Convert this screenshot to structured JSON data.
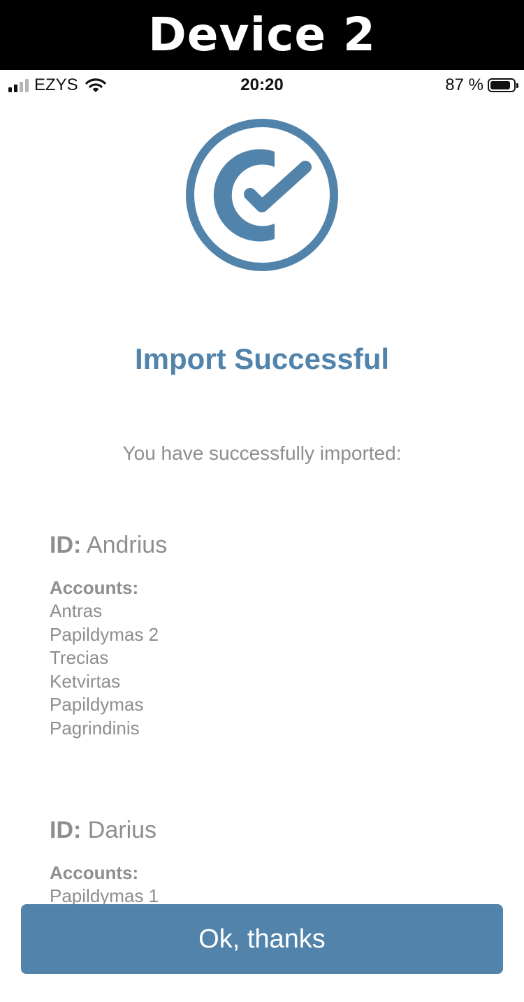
{
  "banner": {
    "title": "Device 2"
  },
  "status_bar": {
    "carrier": "EZYS",
    "time": "20:20",
    "battery_text": "87 %",
    "battery_level": 0.87,
    "signal_bars_active": 2,
    "signal_bars_total": 4,
    "icons": [
      "signal-icon",
      "wifi-icon",
      "battery-icon"
    ]
  },
  "logo": {
    "icon": "check-circle-logo-icon",
    "color": "#5283aa"
  },
  "main": {
    "title": "Import Successful",
    "subtitle": "You have successfully imported:"
  },
  "identities": [
    {
      "id_label": "ID:",
      "id_value": "Andrius",
      "accounts_label": "Accounts:",
      "accounts": [
        "Antras",
        "Papildymas 2",
        "Trecias",
        "Ketvirtas",
        "Papildymas",
        "Pagrindinis"
      ]
    },
    {
      "id_label": "ID:",
      "id_value": "Darius",
      "accounts_label": "Accounts:",
      "accounts": [
        "Papildymas 1"
      ]
    }
  ],
  "footer": {
    "button_label": "Ok, thanks"
  },
  "colors": {
    "accent": "#5283aa",
    "text_muted": "#8e8e8e",
    "banner_bg": "#000000"
  }
}
